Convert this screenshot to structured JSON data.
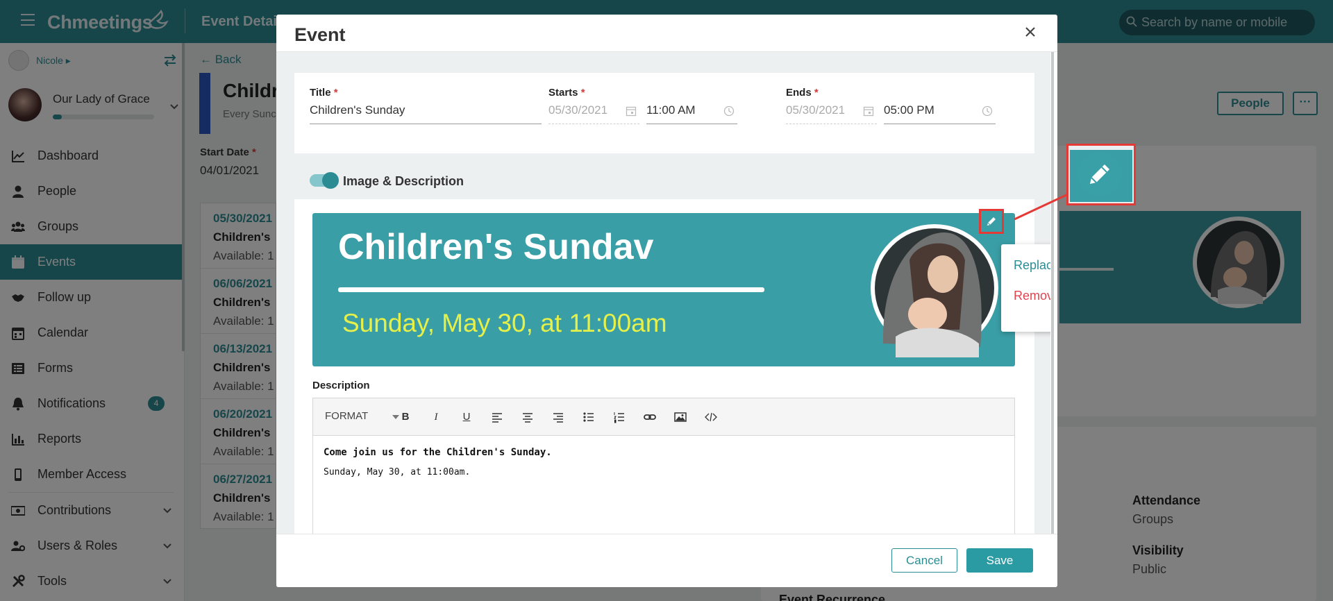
{
  "app": {
    "brand": "Chmeetings",
    "page_crumb": "Event Detai",
    "search_placeholder": "Search by name or mobile"
  },
  "sidebar": {
    "user_name": "Nicole",
    "org_name": "Our Lady of Grace",
    "org_progress": 0.09,
    "items": [
      {
        "label": "Dashboard",
        "icon": "chart-line-icon"
      },
      {
        "label": "People",
        "icon": "person-icon"
      },
      {
        "label": "Groups",
        "icon": "users-icon"
      },
      {
        "label": "Events",
        "icon": "calendar-icon",
        "active": true
      },
      {
        "label": "Follow up",
        "icon": "handshake-icon"
      },
      {
        "label": "Calendar",
        "icon": "calendar-grid-icon"
      },
      {
        "label": "Forms",
        "icon": "list-icon"
      },
      {
        "label": "Notifications",
        "icon": "bell-icon",
        "badge": "4"
      },
      {
        "label": "Reports",
        "icon": "bar-chart-icon"
      },
      {
        "label": "Member Access",
        "icon": "mobile-icon"
      },
      {
        "label": "Contributions",
        "icon": "money-icon"
      },
      {
        "label": "Users & Roles",
        "icon": "users-cog-icon"
      },
      {
        "label": "Tools",
        "icon": "tools-icon"
      }
    ]
  },
  "background": {
    "back_label": "← Back",
    "title": "Childr",
    "subtitle": "Every Sunc",
    "start_date_label": "Start Date",
    "start_date_value": "04/01/2021",
    "occurrences": [
      {
        "date": "05/30/2021",
        "name": "Children's",
        "avail": "Available: 1"
      },
      {
        "date": "06/06/2021",
        "name": "Children's",
        "avail": "Available: 1"
      },
      {
        "date": "06/13/2021",
        "name": "Children's",
        "avail": "Available: 1"
      },
      {
        "date": "06/20/2021",
        "name": "Children's",
        "avail": "Available: 1"
      },
      {
        "date": "06/27/2021",
        "name": "Children's",
        "avail": "Available: 1"
      }
    ],
    "people_button": "People",
    "more_button": "···",
    "attendance_label": "Attendance",
    "attendance_value": "Groups",
    "visibility_label": "Visibility",
    "visibility_value": "Public",
    "recurrence_label": "Event Recurrence"
  },
  "modal": {
    "title": "Event",
    "fields": {
      "title_label": "Title",
      "title_value": "Children's Sunday",
      "starts_label": "Starts",
      "starts_date": "05/30/2021",
      "starts_time": "11:00 AM",
      "ends_label": "Ends",
      "ends_date": "05/30/2021",
      "ends_time": "05:00 PM"
    },
    "section_label": "Image & Description",
    "banner": {
      "title": "Children's Sundav",
      "subtitle": "Sunday, May 30, at 11:00am"
    },
    "image_menu": {
      "replace": "Replace Image",
      "remove": "Remove Image"
    },
    "description_label": "Description",
    "toolbar": {
      "format": "FORMAT",
      "bold": "B",
      "italic": "I",
      "underline": "U"
    },
    "description": {
      "line1": "Come join us for the Children's Sunday.",
      "line2": "Sunday, May 30, at 11:00am."
    },
    "cancel_label": "Cancel",
    "save_label": "Save"
  },
  "colors": {
    "brand": "#2c8c94",
    "danger": "#e53935",
    "banner_bg": "#3a9ea6",
    "banner_date": "#e6f04a"
  }
}
